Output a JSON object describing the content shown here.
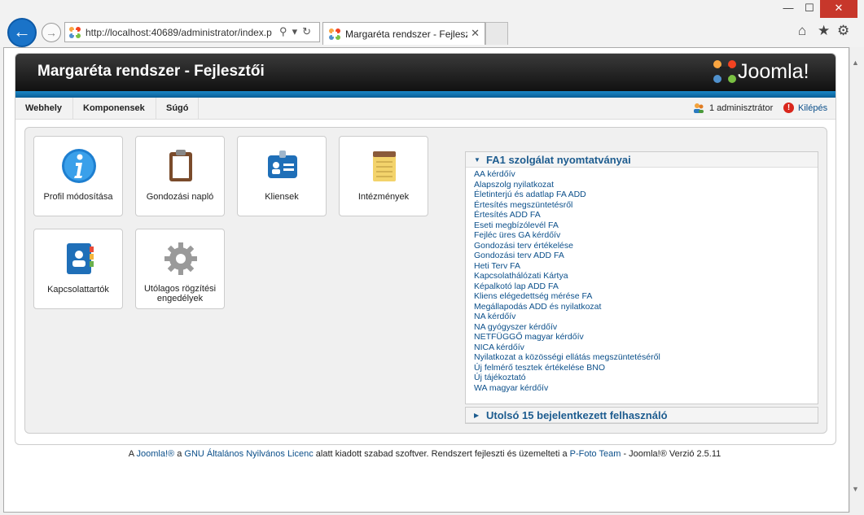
{
  "browser": {
    "address": "http://localhost:40689/administrator/index.p",
    "tab_title": "Margaréta rendszer - Fejlesz...",
    "window_buttons": {
      "minimize": "—",
      "maximize": "☐",
      "close": "✕"
    }
  },
  "header": {
    "site_title": "Margaréta rendszer - Fejlesztői",
    "logo_text": "Joomla!"
  },
  "menu": {
    "items": [
      "Webhely",
      "Komponensek",
      "Súgó"
    ],
    "user": "1 adminisztrátor",
    "logout": "Kilépés"
  },
  "quick_icons": [
    {
      "label": "Profil módosítása",
      "icon": "info-icon"
    },
    {
      "label": "Gondozási napló",
      "icon": "clipboard-icon"
    },
    {
      "label": "Kliensek",
      "icon": "id-card-icon"
    },
    {
      "label": "Intézmények",
      "icon": "notepad-icon"
    },
    {
      "label": "Kapcsolattartók",
      "icon": "address-book-icon"
    },
    {
      "label": "Utólagos rögzítési engedélyek",
      "icon": "gear-icon"
    }
  ],
  "panel1": {
    "title": "FA1 szolgálat nyomtatványai",
    "links": [
      "AA kérdőív",
      "Alapszolg nyilatkozat",
      "Életinterjú és adatlap FA ADD",
      "Értesítés megszüntetésről",
      "Értesítés ADD FA",
      "Eseti megbízólevél FA",
      "Fejléc üres GA kérdőív",
      "Gondozási terv értékelése",
      "Gondozási terv ADD FA",
      "Heti Terv FA",
      "Kapcsolathálózati Kártya",
      "Képalkotó lap ADD FA",
      "Kliens elégedettség mérése FA",
      "Megállapodás ADD és nyilatkozat",
      "NA kérdőív",
      "NA gyógyszer kérdőív",
      "NETFÜGGŐ magyar kérdőív",
      "NICA kérdőív",
      "Nyilatkozat a közösségi ellátás megszüntetéséről",
      "Új felmérő tesztek értékelése BNO",
      "Új tájékoztató",
      "WA magyar kérdőív"
    ]
  },
  "panel2": {
    "title": "Utolsó 15 bejelentkezett felhasználó"
  },
  "footer": {
    "t1": "A ",
    "l1": "Joomla!®",
    "t2": " a ",
    "l2": "GNU Általános Nyilvános Licenc",
    "t3": " alatt kiadott szabad szoftver. Rendszert fejleszti és üzemelteti a ",
    "l3": "P-Foto Team",
    "t4": "   - Joomla!® Verzió 2.5.11"
  }
}
